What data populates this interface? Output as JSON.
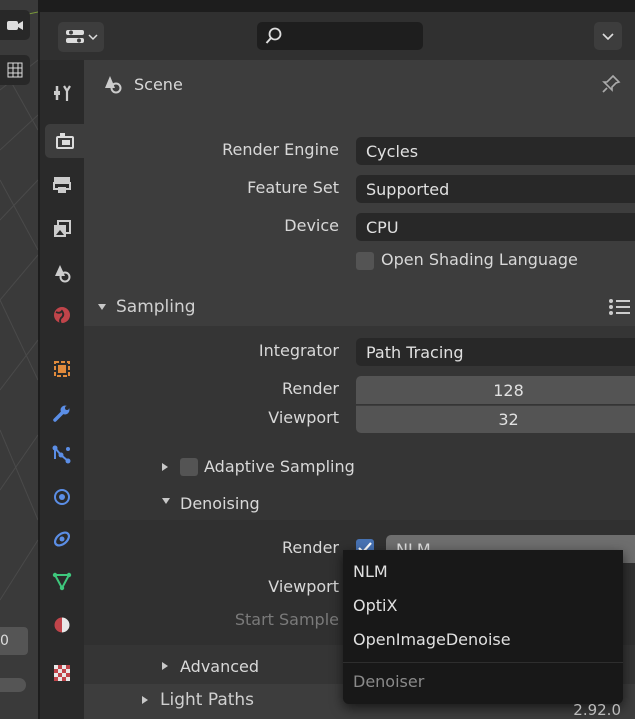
{
  "header": {
    "search": {
      "value": "",
      "placeholder": ""
    }
  },
  "context": {
    "label": "Scene"
  },
  "render": {
    "engine_label": "Render Engine",
    "engine_value": "Cycles",
    "feature_label": "Feature Set",
    "feature_value": "Supported",
    "device_label": "Device",
    "device_value": "CPU",
    "osl_label": "Open Shading Language",
    "osl_checked": false
  },
  "sampling": {
    "title": "Sampling",
    "integrator_label": "Integrator",
    "integrator_value": "Path Tracing",
    "render_label": "Render",
    "render_value": "128",
    "viewport_label": "Viewport",
    "viewport_value": "32",
    "adaptive_label": "Adaptive Sampling",
    "adaptive_checked": false,
    "denoising_title": "Denoising",
    "denoise_render_label": "Render",
    "denoise_render_checked": true,
    "denoise_render_value": "NLM",
    "denoise_viewport_label": "Viewport",
    "denoise_viewport_checked": false,
    "start_sample_label": "Start Sample",
    "advanced_title": "Advanced"
  },
  "light_paths": {
    "title": "Light Paths"
  },
  "denoiser_menu": {
    "items": [
      "NLM",
      "OptiX",
      "OpenImageDenoise"
    ],
    "title": "Denoiser"
  },
  "viewport_strip": {
    "field_value": "0"
  },
  "status": {
    "version": "2.92.0"
  },
  "colors": {
    "accent": "#4772b3",
    "panel": "#3d3d3d",
    "field": "#282828",
    "number_field": "#545454"
  }
}
